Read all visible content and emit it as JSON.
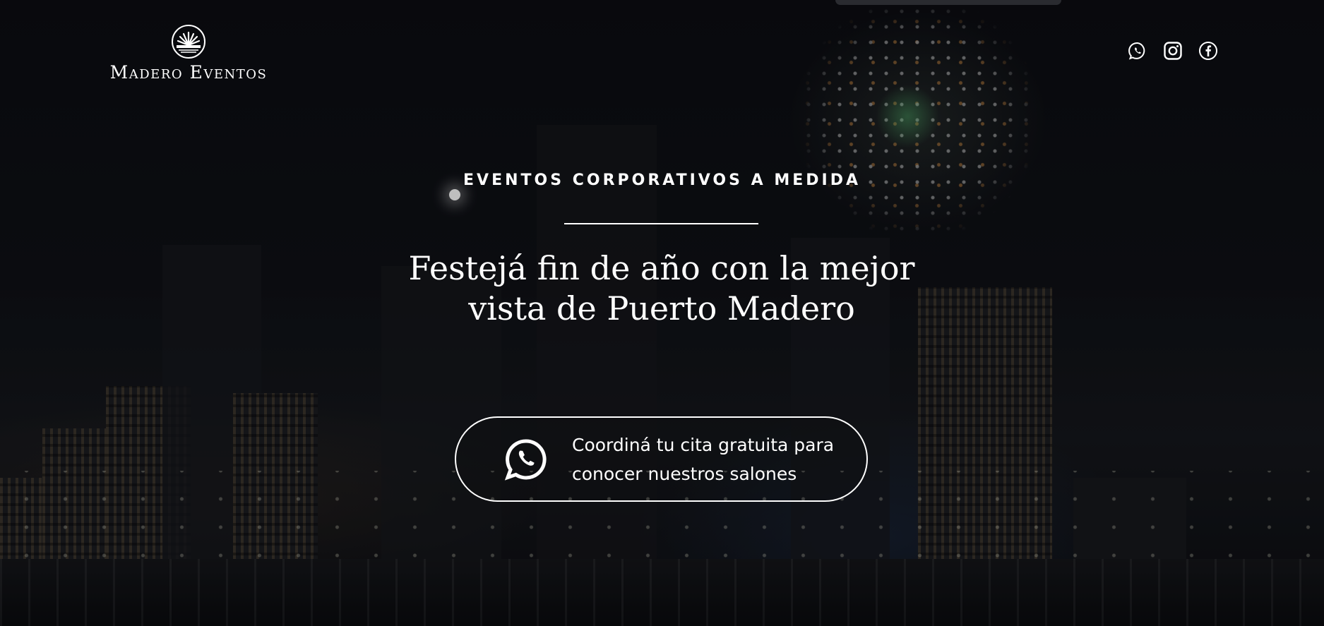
{
  "brand": {
    "name": "Madero Eventos"
  },
  "social": {
    "items": [
      {
        "icon": "whatsapp-icon"
      },
      {
        "icon": "instagram-icon"
      },
      {
        "icon": "facebook-icon"
      }
    ]
  },
  "hero": {
    "kicker": "EVENTOS CORPORATIVOS A MEDIDA",
    "headline_line1": "Festejá fin de año con la mejor",
    "headline_line2": "vista de Puerto Madero",
    "cta": {
      "icon": "whatsapp-icon",
      "line1": "Coordiná tu cita gratuita para",
      "line2": "conocer nuestros salones"
    }
  },
  "colors": {
    "text": "#ffffff",
    "background": "#0b0c10"
  }
}
